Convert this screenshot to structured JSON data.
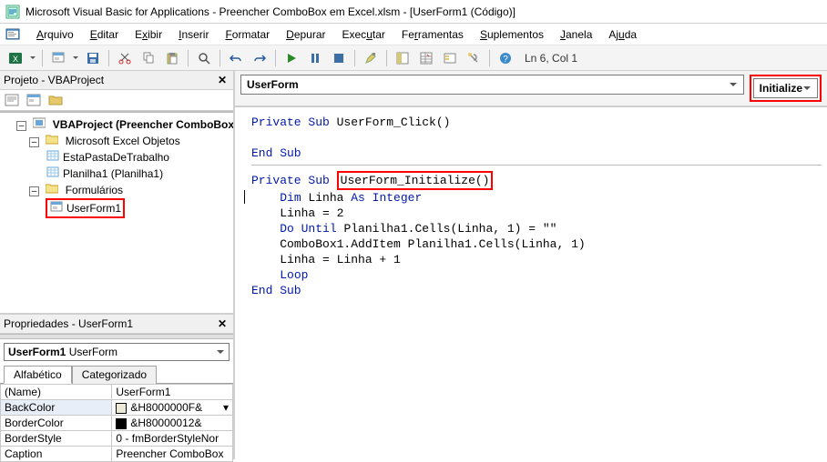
{
  "title": "Microsoft Visual Basic for Applications - Preencher ComboBox em Excel.xlsm - [UserForm1 (Código)]",
  "menubar": {
    "items": [
      {
        "label": "Arquivo",
        "u": "A"
      },
      {
        "label": "Editar",
        "u": "E"
      },
      {
        "label": "Exibir",
        "u": "E"
      },
      {
        "label": "Inserir",
        "u": "I"
      },
      {
        "label": "Formatar",
        "u": "F"
      },
      {
        "label": "Depurar",
        "u": "D"
      },
      {
        "label": "Executar",
        "u": "E"
      },
      {
        "label": "Ferramentas",
        "u": "F"
      },
      {
        "label": "Suplementos",
        "u": "S"
      },
      {
        "label": "Janela",
        "u": "J"
      },
      {
        "label": "Ajuda",
        "u": "A"
      }
    ]
  },
  "toolbar": {
    "status": "Ln 6, Col 1"
  },
  "project_panel_title": "Projeto - VBAProject",
  "tree": {
    "root": "VBAProject (Preencher ComboBox",
    "grp1": "Microsoft Excel Objetos",
    "leaf1": "EstaPastaDeTrabalho",
    "leaf2": "Planilha1 (Planilha1)",
    "grp2": "Formulários",
    "leaf3": "UserForm1"
  },
  "props_panel_title": "Propriedades - UserForm1",
  "props_combo_name": "UserForm1",
  "props_combo_type": "UserForm",
  "tabs": {
    "t1": "Alfabético",
    "t2": "Categorizado"
  },
  "props": [
    {
      "k": "(Name)",
      "v": "UserForm1"
    },
    {
      "k": "BackColor",
      "v": "&H8000000F&",
      "sw": "#ece9d8",
      "dd": true
    },
    {
      "k": "BorderColor",
      "v": "&H80000012&",
      "sw": "#000000"
    },
    {
      "k": "BorderStyle",
      "v": "0 - fmBorderStyleNor"
    },
    {
      "k": "Caption",
      "v": "Preencher ComboBox"
    }
  ],
  "code_combo": {
    "object": "UserForm",
    "proc": "Initialize"
  },
  "code": {
    "l1a": "Private Sub",
    "l1b": " UserForm_Click()",
    "l2": "End Sub",
    "l3a": "Private Sub",
    "l3b": " ",
    "l3c": "UserForm_Initialize()",
    "l4a": "Dim",
    "l4b": " Linha ",
    "l4c": "As Integer",
    "l5": "Linha = 2",
    "l6a": "Do Until",
    "l6b": " Planilha1.Cells(Linha, 1) = \"\"",
    "l7": "ComboBox1.AddItem Planilha1.Cells(Linha, 1)",
    "l8": "Linha = Linha + 1",
    "l9": "Loop",
    "l10": "End Sub"
  }
}
